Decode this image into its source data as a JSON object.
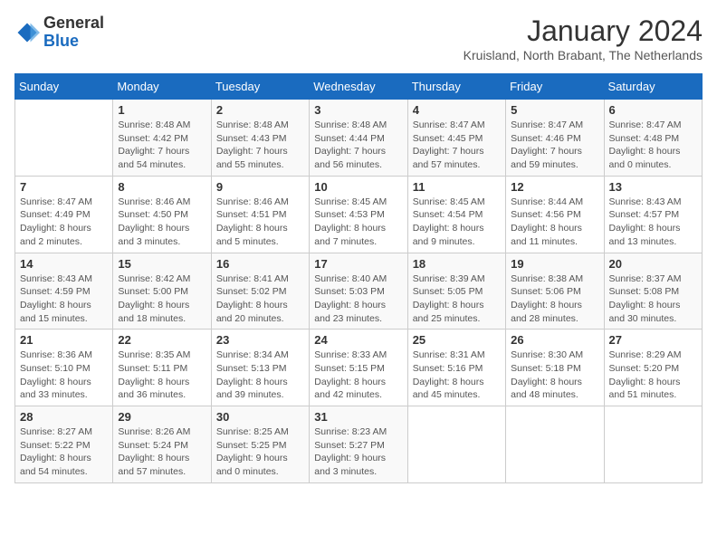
{
  "header": {
    "logo_general": "General",
    "logo_blue": "Blue",
    "month_title": "January 2024",
    "subtitle": "Kruisland, North Brabant, The Netherlands"
  },
  "days_of_week": [
    "Sunday",
    "Monday",
    "Tuesday",
    "Wednesday",
    "Thursday",
    "Friday",
    "Saturday"
  ],
  "weeks": [
    [
      {
        "day": "",
        "sunrise": "",
        "sunset": "",
        "daylight": ""
      },
      {
        "day": "1",
        "sunrise": "Sunrise: 8:48 AM",
        "sunset": "Sunset: 4:42 PM",
        "daylight": "Daylight: 7 hours and 54 minutes."
      },
      {
        "day": "2",
        "sunrise": "Sunrise: 8:48 AM",
        "sunset": "Sunset: 4:43 PM",
        "daylight": "Daylight: 7 hours and 55 minutes."
      },
      {
        "day": "3",
        "sunrise": "Sunrise: 8:48 AM",
        "sunset": "Sunset: 4:44 PM",
        "daylight": "Daylight: 7 hours and 56 minutes."
      },
      {
        "day": "4",
        "sunrise": "Sunrise: 8:47 AM",
        "sunset": "Sunset: 4:45 PM",
        "daylight": "Daylight: 7 hours and 57 minutes."
      },
      {
        "day": "5",
        "sunrise": "Sunrise: 8:47 AM",
        "sunset": "Sunset: 4:46 PM",
        "daylight": "Daylight: 7 hours and 59 minutes."
      },
      {
        "day": "6",
        "sunrise": "Sunrise: 8:47 AM",
        "sunset": "Sunset: 4:48 PM",
        "daylight": "Daylight: 8 hours and 0 minutes."
      }
    ],
    [
      {
        "day": "7",
        "sunrise": "Sunrise: 8:47 AM",
        "sunset": "Sunset: 4:49 PM",
        "daylight": "Daylight: 8 hours and 2 minutes."
      },
      {
        "day": "8",
        "sunrise": "Sunrise: 8:46 AM",
        "sunset": "Sunset: 4:50 PM",
        "daylight": "Daylight: 8 hours and 3 minutes."
      },
      {
        "day": "9",
        "sunrise": "Sunrise: 8:46 AM",
        "sunset": "Sunset: 4:51 PM",
        "daylight": "Daylight: 8 hours and 5 minutes."
      },
      {
        "day": "10",
        "sunrise": "Sunrise: 8:45 AM",
        "sunset": "Sunset: 4:53 PM",
        "daylight": "Daylight: 8 hours and 7 minutes."
      },
      {
        "day": "11",
        "sunrise": "Sunrise: 8:45 AM",
        "sunset": "Sunset: 4:54 PM",
        "daylight": "Daylight: 8 hours and 9 minutes."
      },
      {
        "day": "12",
        "sunrise": "Sunrise: 8:44 AM",
        "sunset": "Sunset: 4:56 PM",
        "daylight": "Daylight: 8 hours and 11 minutes."
      },
      {
        "day": "13",
        "sunrise": "Sunrise: 8:43 AM",
        "sunset": "Sunset: 4:57 PM",
        "daylight": "Daylight: 8 hours and 13 minutes."
      }
    ],
    [
      {
        "day": "14",
        "sunrise": "Sunrise: 8:43 AM",
        "sunset": "Sunset: 4:59 PM",
        "daylight": "Daylight: 8 hours and 15 minutes."
      },
      {
        "day": "15",
        "sunrise": "Sunrise: 8:42 AM",
        "sunset": "Sunset: 5:00 PM",
        "daylight": "Daylight: 8 hours and 18 minutes."
      },
      {
        "day": "16",
        "sunrise": "Sunrise: 8:41 AM",
        "sunset": "Sunset: 5:02 PM",
        "daylight": "Daylight: 8 hours and 20 minutes."
      },
      {
        "day": "17",
        "sunrise": "Sunrise: 8:40 AM",
        "sunset": "Sunset: 5:03 PM",
        "daylight": "Daylight: 8 hours and 23 minutes."
      },
      {
        "day": "18",
        "sunrise": "Sunrise: 8:39 AM",
        "sunset": "Sunset: 5:05 PM",
        "daylight": "Daylight: 8 hours and 25 minutes."
      },
      {
        "day": "19",
        "sunrise": "Sunrise: 8:38 AM",
        "sunset": "Sunset: 5:06 PM",
        "daylight": "Daylight: 8 hours and 28 minutes."
      },
      {
        "day": "20",
        "sunrise": "Sunrise: 8:37 AM",
        "sunset": "Sunset: 5:08 PM",
        "daylight": "Daylight: 8 hours and 30 minutes."
      }
    ],
    [
      {
        "day": "21",
        "sunrise": "Sunrise: 8:36 AM",
        "sunset": "Sunset: 5:10 PM",
        "daylight": "Daylight: 8 hours and 33 minutes."
      },
      {
        "day": "22",
        "sunrise": "Sunrise: 8:35 AM",
        "sunset": "Sunset: 5:11 PM",
        "daylight": "Daylight: 8 hours and 36 minutes."
      },
      {
        "day": "23",
        "sunrise": "Sunrise: 8:34 AM",
        "sunset": "Sunset: 5:13 PM",
        "daylight": "Daylight: 8 hours and 39 minutes."
      },
      {
        "day": "24",
        "sunrise": "Sunrise: 8:33 AM",
        "sunset": "Sunset: 5:15 PM",
        "daylight": "Daylight: 8 hours and 42 minutes."
      },
      {
        "day": "25",
        "sunrise": "Sunrise: 8:31 AM",
        "sunset": "Sunset: 5:16 PM",
        "daylight": "Daylight: 8 hours and 45 minutes."
      },
      {
        "day": "26",
        "sunrise": "Sunrise: 8:30 AM",
        "sunset": "Sunset: 5:18 PM",
        "daylight": "Daylight: 8 hours and 48 minutes."
      },
      {
        "day": "27",
        "sunrise": "Sunrise: 8:29 AM",
        "sunset": "Sunset: 5:20 PM",
        "daylight": "Daylight: 8 hours and 51 minutes."
      }
    ],
    [
      {
        "day": "28",
        "sunrise": "Sunrise: 8:27 AM",
        "sunset": "Sunset: 5:22 PM",
        "daylight": "Daylight: 8 hours and 54 minutes."
      },
      {
        "day": "29",
        "sunrise": "Sunrise: 8:26 AM",
        "sunset": "Sunset: 5:24 PM",
        "daylight": "Daylight: 8 hours and 57 minutes."
      },
      {
        "day": "30",
        "sunrise": "Sunrise: 8:25 AM",
        "sunset": "Sunset: 5:25 PM",
        "daylight": "Daylight: 9 hours and 0 minutes."
      },
      {
        "day": "31",
        "sunrise": "Sunrise: 8:23 AM",
        "sunset": "Sunset: 5:27 PM",
        "daylight": "Daylight: 9 hours and 3 minutes."
      },
      {
        "day": "",
        "sunrise": "",
        "sunset": "",
        "daylight": ""
      },
      {
        "day": "",
        "sunrise": "",
        "sunset": "",
        "daylight": ""
      },
      {
        "day": "",
        "sunrise": "",
        "sunset": "",
        "daylight": ""
      }
    ]
  ]
}
